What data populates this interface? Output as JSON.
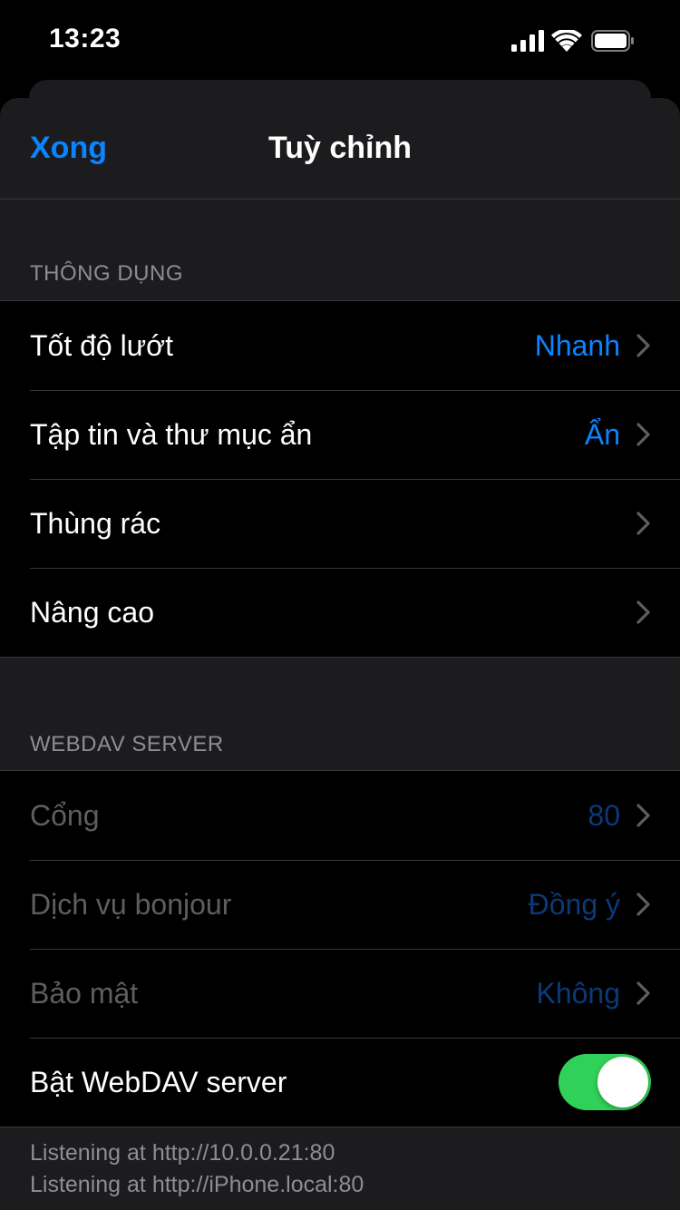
{
  "status_bar": {
    "time": "13:23",
    "icons": [
      "signal-icon",
      "wifi-icon",
      "battery-icon"
    ]
  },
  "nav": {
    "done_label": "Xong",
    "title": "Tuỳ chỉnh"
  },
  "sections": [
    {
      "header": "THÔNG DỤNG",
      "rows": [
        {
          "label": "Tốt độ lướt",
          "value": "Nhanh"
        },
        {
          "label": "Tập tin và thư mục ẩn",
          "value": "Ẩn"
        },
        {
          "label": "Thùng rác",
          "value": ""
        },
        {
          "label": "Nâng cao",
          "value": ""
        }
      ]
    },
    {
      "header": "WEBDAV SERVER",
      "rows": [
        {
          "label": "Cổng",
          "value": "80"
        },
        {
          "label": "Dịch vụ bonjour",
          "value": "Đồng ý"
        },
        {
          "label": "Bảo mật",
          "value": "Không"
        },
        {
          "label": "Bật WebDAV server",
          "toggle_on": true
        }
      ],
      "footer": [
        "Listening at http://10.0.0.21:80",
        "Listening at http://iPhone.local:80"
      ]
    }
  ],
  "colors": {
    "accent": "#0a84ff",
    "toggle_on": "#30d158",
    "background": "#000000",
    "grouped_bg": "#1c1c1e"
  }
}
